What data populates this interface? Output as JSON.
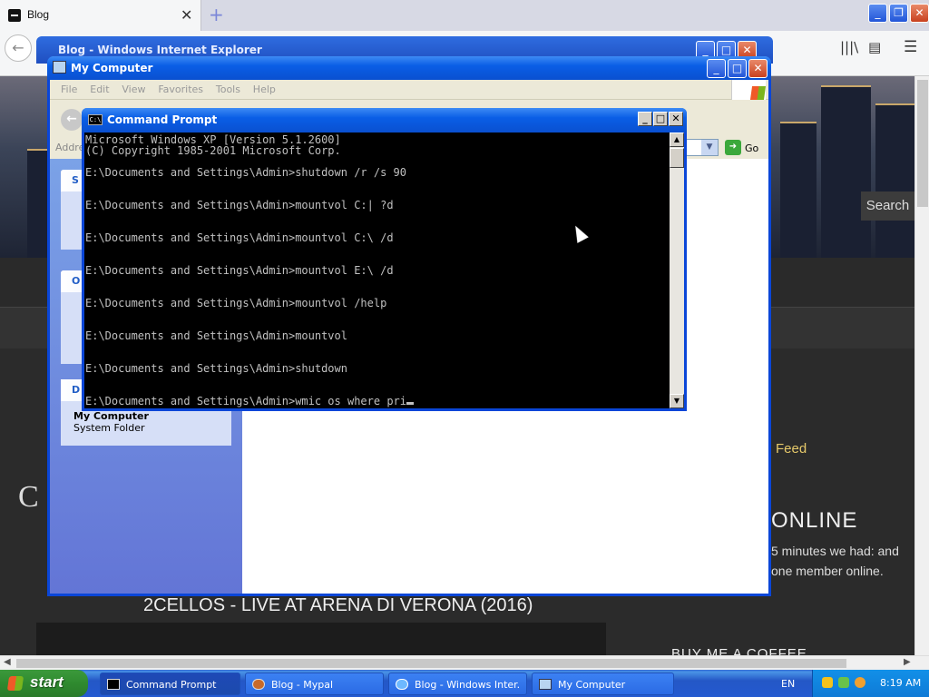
{
  "firefox": {
    "tab_title": "Blog",
    "tab_close": "✕",
    "new_tab": "+",
    "back": "←",
    "library_icon": "library-icon",
    "menu": "☰"
  },
  "blog": {
    "search_button": "Search",
    "feed_link": "Feed",
    "online_title": "ONLINE",
    "online_text": "5 minutes we had: and one member online.",
    "video_title": "2CELLOS - LIVE AT ARENA DI VERONA (2016)",
    "coffee_heading": "BUY ME A COFFEE",
    "big_letter": "C"
  },
  "ie": {
    "title": "Blog - Windows Internet Explorer"
  },
  "my_computer": {
    "title": "My Computer",
    "menus": [
      "File",
      "Edit",
      "View",
      "Favorites",
      "Tools",
      "Help"
    ],
    "address_label": "Addre",
    "go_label": "Go",
    "task_headers": [
      "S",
      "O"
    ],
    "details_header": "D",
    "details_name": "My Computer",
    "details_type": "System Folder"
  },
  "cmd": {
    "title": "Command Prompt",
    "lines": [
      "Microsoft Windows XP [Version 5.1.2600]",
      "(C) Copyright 1985-2001 Microsoft Corp.",
      "",
      "E:\\Documents and Settings\\Admin>shutdown /r /s 90",
      "",
      "",
      "E:\\Documents and Settings\\Admin>mountvol C:| ?d",
      "",
      "",
      "E:\\Documents and Settings\\Admin>mountvol C:\\ /d",
      "",
      "",
      "E:\\Documents and Settings\\Admin>mountvol E:\\ /d",
      "",
      "",
      "E:\\Documents and Settings\\Admin>mountvol /help",
      "",
      "",
      "E:\\Documents and Settings\\Admin>mountvol",
      "",
      "",
      "E:\\Documents and Settings\\Admin>shutdown",
      "",
      "",
      "E:\\Documents and Settings\\Admin>wmic os where pri"
    ]
  },
  "taskbar": {
    "start_label": "start",
    "tasks": [
      {
        "label": "Command Prompt",
        "icon": "cmd-icon"
      },
      {
        "label": "Blog - Mypal",
        "icon": "mypal-icon"
      },
      {
        "label": "Blog - Windows Inter...",
        "icon": "ie-icon"
      },
      {
        "label": "My Computer",
        "icon": "my-computer-icon"
      }
    ],
    "language": "EN",
    "clock": "8:19 AM"
  }
}
